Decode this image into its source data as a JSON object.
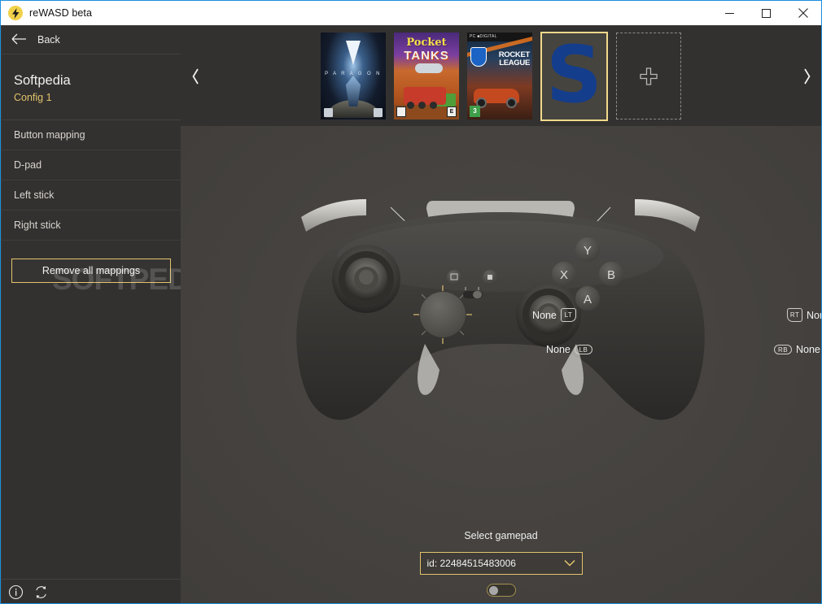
{
  "window": {
    "title": "reWASD beta",
    "app_icon": "lightning-bolt-icon",
    "minimize_label": "─",
    "maximize_label": "□",
    "close_label": "✕",
    "accent_border": "#1b8fe0"
  },
  "sidebar": {
    "back_label": "Back",
    "profile_name": "Softpedia",
    "profile_config": "Config 1",
    "nav_items": [
      {
        "label": "Button mapping",
        "name": "sidebar-item-button-mapping"
      },
      {
        "label": "D-pad",
        "name": "sidebar-item-dpad"
      },
      {
        "label": "Left stick",
        "name": "sidebar-item-left-stick"
      },
      {
        "label": "Right stick",
        "name": "sidebar-item-right-stick"
      }
    ],
    "remove_all_label": "Remove all mappings",
    "remove_all_border_color": "#e2c46d",
    "footer_icons": [
      "info-icon",
      "refresh-icon"
    ],
    "background": "#333130",
    "config_color": "#e0c36a"
  },
  "watermark": {
    "text": "SOFTPEDIA",
    "mark": "®"
  },
  "game_strip": {
    "prev_arrow": "‹",
    "next_arrow": "›",
    "tiles": [
      {
        "name": "game-tile-paragon",
        "title": "PARAGON",
        "type": "cover-paragon",
        "selected": false
      },
      {
        "name": "game-tile-pocket-tanks",
        "title": "Pocket TANKS",
        "type": "cover-tanks",
        "selected": false
      },
      {
        "name": "game-tile-rocket-league",
        "title": "ROCKET LEAGUE",
        "type": "cover-rocket",
        "selected": false
      },
      {
        "name": "game-tile-softpedia",
        "title": "S",
        "type": "cover-letter",
        "selected": true
      },
      {
        "name": "game-tile-add",
        "title": "",
        "type": "add",
        "selected": false
      }
    ],
    "paragon": {
      "title": "P A R A G O N"
    },
    "tanks": {
      "title_top": "Pocket",
      "title_bottom": "TANKS",
      "rating": "E"
    },
    "rocket": {
      "pc_label": "PC ■DIGITAL",
      "title_line1": "ROCKET",
      "title_line2": "LEAGUE",
      "rating": "3"
    },
    "selected_letter": "S",
    "selected_border": "#f0d98a",
    "add_icon": "plus-icon"
  },
  "gamepad": {
    "image_name": "xbox-elite-controller",
    "mappings": [
      {
        "id": "lt",
        "button": "LT",
        "value": "None",
        "side": "left",
        "shape": "trigger"
      },
      {
        "id": "lb",
        "button": "LB",
        "value": "None",
        "side": "left",
        "shape": "bumper"
      },
      {
        "id": "rt",
        "button": "RT",
        "value": "None",
        "side": "right",
        "shape": "trigger"
      },
      {
        "id": "rb",
        "button": "RB",
        "value": "None",
        "side": "right",
        "shape": "bumper"
      }
    ],
    "face_buttons": [
      "Y",
      "X",
      "B",
      "A"
    ]
  },
  "bottom": {
    "select_gamepad_label": "Select gamepad",
    "selected_gamepad": "id: 22484515483006",
    "dropdown_chevron": "chevron-down-icon",
    "dropdown_border_color": "#e2c46d",
    "toggle_state": "off"
  }
}
